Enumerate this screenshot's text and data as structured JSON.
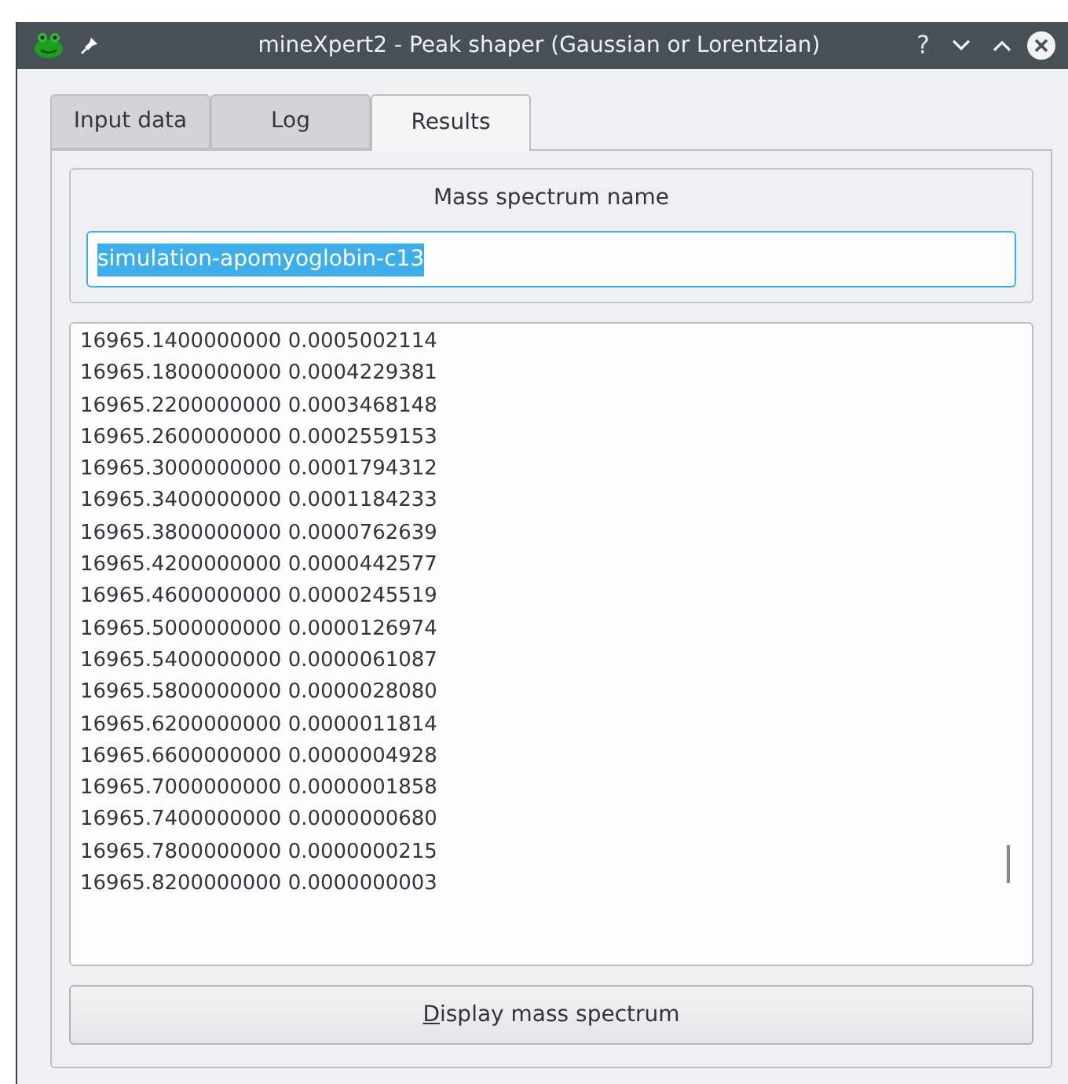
{
  "window": {
    "title": "mineXpert2 - Peak shaper (Gaussian or Lorentzian)",
    "controls": [
      "?"
    ]
  },
  "tabs": [
    {
      "label": "Input data",
      "selected": false
    },
    {
      "label": "Log",
      "selected": false
    },
    {
      "label": "Results",
      "selected": true
    }
  ],
  "name_group": {
    "title": "Mass spectrum name",
    "value": "simulation-apomyoglobin-c13",
    "text_selected": true
  },
  "results_lines": [
    "16965.1400000000 0.0005002114",
    "16965.1800000000 0.0004229381",
    "16965.2200000000 0.0003468148",
    "16965.2600000000 0.0002559153",
    "16965.3000000000 0.0001794312",
    "16965.3400000000 0.0001184233",
    "16965.3800000000 0.0000762639",
    "16965.4200000000 0.0000442577",
    "16965.4600000000 0.0000245519",
    "16965.5000000000 0.0000126974",
    "16965.5400000000 0.0000061087",
    "16965.5800000000 0.0000028080",
    "16965.6200000000 0.0000011814",
    "16965.6600000000 0.0000004928",
    "16965.7000000000 0.0000001858",
    "16965.7400000000 0.0000000680",
    "16965.7800000000 0.0000000215",
    "16965.8200000000 0.0000000003"
  ],
  "display_button": {
    "label": "Display mass spectrum",
    "first_letter_underlined": true
  }
}
